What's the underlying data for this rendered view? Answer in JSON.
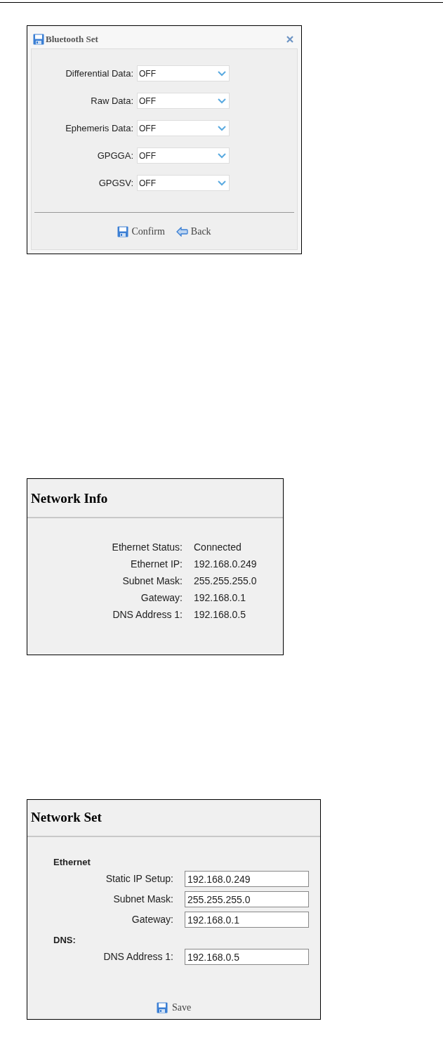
{
  "bluetooth_set": {
    "title": "Bluetooth Set",
    "fields": [
      {
        "label": "Differential Data:",
        "value": "OFF"
      },
      {
        "label": "Raw Data:",
        "value": "OFF"
      },
      {
        "label": "Ephemeris Data:",
        "value": "OFF"
      },
      {
        "label": "GPGGA:",
        "value": "OFF"
      },
      {
        "label": "GPGSV:",
        "value": "OFF"
      }
    ],
    "buttons": [
      {
        "label": "Confirm",
        "kind": "save"
      },
      {
        "label": "Back",
        "kind": "back"
      }
    ]
  },
  "network_info": {
    "title": "Network Info",
    "rows": [
      {
        "label": "Ethernet Status:",
        "value": "Connected"
      },
      {
        "label": "Ethernet IP:",
        "value": "192.168.0.249"
      },
      {
        "label": "Subnet Mask:",
        "value": "255.255.255.0"
      },
      {
        "label": "Gateway:",
        "value": "192.168.0.1"
      },
      {
        "label": "DNS Address 1:",
        "value": "192.168.0.5"
      }
    ]
  },
  "network_set": {
    "title": "Network Set",
    "sections": [
      {
        "heading": "Ethernet",
        "fields": [
          {
            "label": "Static IP Setup:",
            "value": "192.168.0.249"
          },
          {
            "label": "Subnet Mask:",
            "value": "255.255.255.0"
          },
          {
            "label": "Gateway:",
            "value": "192.168.0.1"
          }
        ]
      },
      {
        "heading": "DNS:",
        "fields": [
          {
            "label": "DNS Address 1:",
            "value": "192.168.0.5"
          }
        ]
      }
    ],
    "button": {
      "label": "Save",
      "kind": "save"
    }
  }
}
